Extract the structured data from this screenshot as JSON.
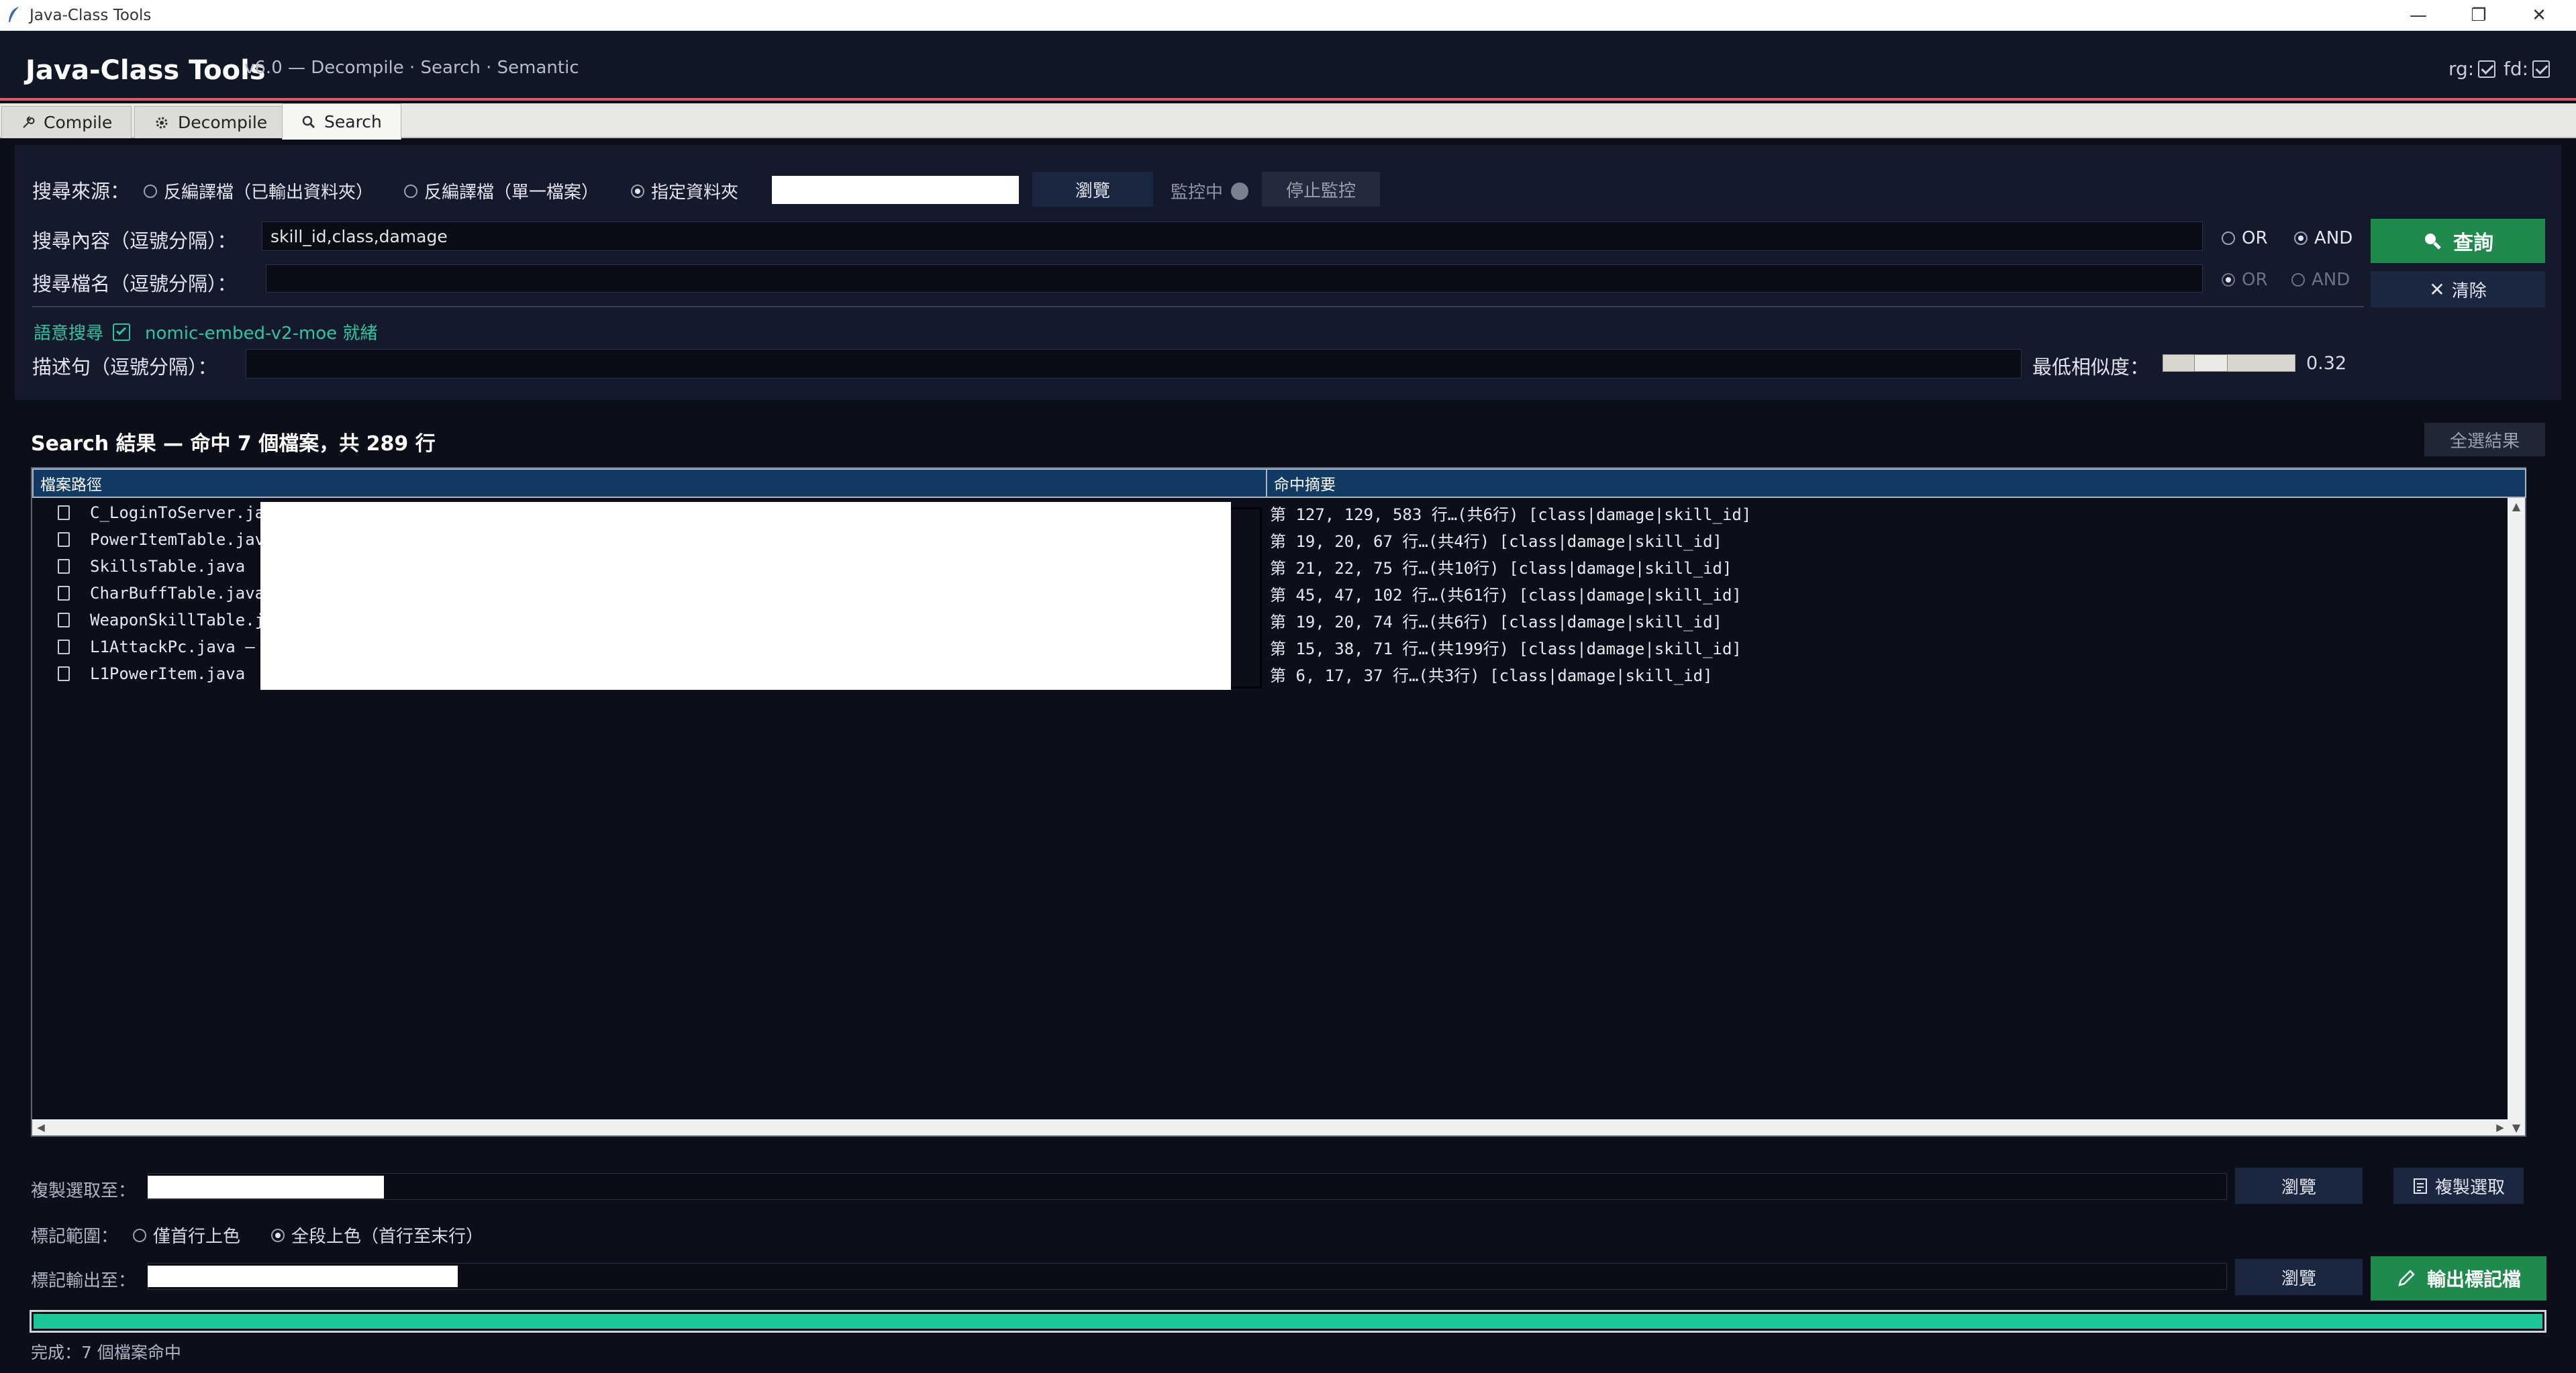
{
  "window": {
    "title": "Java-Class Tools",
    "minimize_glyph": "—",
    "restore_glyph": "❐",
    "close_glyph": "✕"
  },
  "header": {
    "title": "Java-Class Tools",
    "subtitle": "v6.0  —  Decompile · Search · Semantic",
    "rg_label": "rg:",
    "fd_label": "fd:",
    "accent_color": "#d9596b"
  },
  "tabs": [
    {
      "label": "Compile",
      "icon": "wrench-icon"
    },
    {
      "label": "Decompile",
      "icon": "gear-icon"
    },
    {
      "label": "Search",
      "icon": "search-icon",
      "active": true
    }
  ],
  "search": {
    "source_label": "搜尋來源：",
    "source_options": [
      "反編譯檔（已輸出資料夾）",
      "反編譯檔（單一檔案）",
      "指定資料夾"
    ],
    "source_selected": 2,
    "browse_label": "瀏覽",
    "monitoring_label": "監控中",
    "stop_monitor_label": "停止監控",
    "content_label": "搜尋內容（逗號分隔）：",
    "content_value": "skill_id,class,damage",
    "content_or": "OR",
    "content_and": "AND",
    "content_mode": "AND",
    "filename_label": "搜尋檔名（逗號分隔）：",
    "filename_value": "",
    "filename_or": "OR",
    "filename_and": "AND",
    "query_label": "查詢",
    "clear_label": "清除",
    "semantic_label": "語意搜尋",
    "semantic_status": "nomic-embed-v2-moe 就緒",
    "desc_label": "描述句（逗號分隔）：",
    "desc_value": "",
    "similarity_label": "最低相似度：",
    "similarity_value": "0.32",
    "semantic_color": "#2ec4a0"
  },
  "results": {
    "title": "Search 結果 — 命中 7 個檔案，共 289 行",
    "select_all_label": "全選結果",
    "col_path": "檔案路徑",
    "col_summary": "命中摘要",
    "rows": [
      {
        "file": "C_LoginToServer.ja",
        "summary": "第 127, 129, 583 行…(共6行)  [class|damage|skill_id]"
      },
      {
        "file": "PowerItemTable.jav",
        "summary": "第 19, 20, 67 行…(共4行)  [class|damage|skill_id]"
      },
      {
        "file": "SkillsTable.java",
        "summary": "第 21, 22, 75 行…(共10行)  [class|damage|skill_id]"
      },
      {
        "file": "CharBuffTable.java",
        "summary": "第 45, 47, 102 行…(共61行)  [class|damage|skill_id]"
      },
      {
        "file": "WeaponSkillTable.j",
        "summary": "第 19, 20, 74 行…(共6行)  [class|damage|skill_id]"
      },
      {
        "file": "L1AttackPc.java  —",
        "summary": "第 15, 38, 71 行…(共199行)  [class|damage|skill_id]"
      },
      {
        "file": "L1PowerItem.java",
        "summary": "第 6, 17, 37 行…(共3行)  [class|damage|skill_id]"
      }
    ]
  },
  "bottom": {
    "copy_to_label": "複製選取至：",
    "copy_to_value": "",
    "copy_browse_label": "瀏覽",
    "copy_selected_label": "複製選取",
    "mark_range_label": "標記範圍：",
    "mark_options": [
      "僅首行上色",
      "全段上色（首行至末行）"
    ],
    "mark_selected": 1,
    "mark_output_label": "標記輸出至：",
    "mark_output_value": "",
    "mark_browse_label": "瀏覽",
    "export_label": "輸出標記檔",
    "progress_percent": 100,
    "status": "完成：7 個檔案命中",
    "progress_color": "#1bc79a"
  }
}
